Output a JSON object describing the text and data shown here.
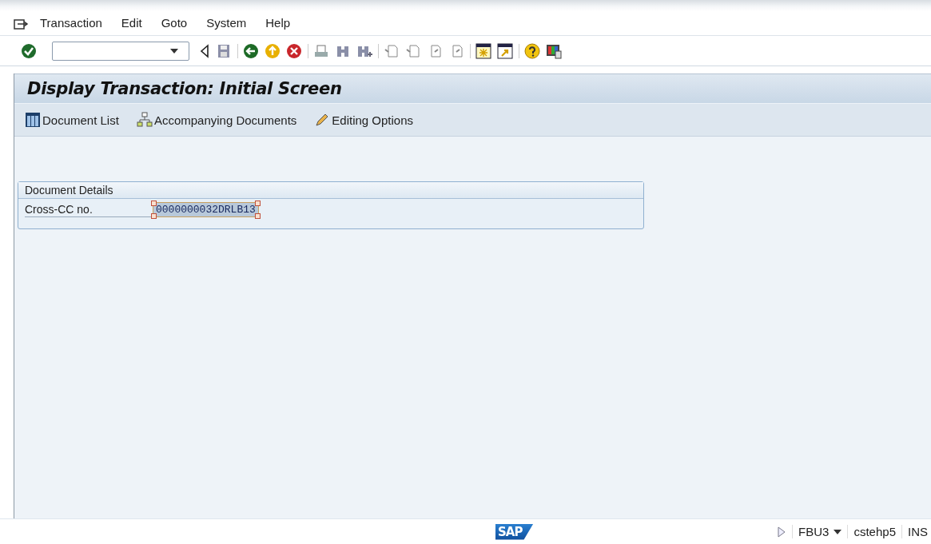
{
  "menu": [
    {
      "label": "Transaction"
    },
    {
      "label": "Edit"
    },
    {
      "label": "Goto"
    },
    {
      "label": "System"
    },
    {
      "label": "Help"
    }
  ],
  "title": "Display Transaction: Initial Screen",
  "app_toolbar": [
    {
      "kind": "list",
      "label": "Document List"
    },
    {
      "kind": "docs",
      "label": "Accompanying Documents"
    },
    {
      "kind": "pencil",
      "label": "Editing Options"
    }
  ],
  "group": {
    "title": "Document Details",
    "fields": [
      {
        "label": "Cross-CC no.",
        "value": "0000000032DRLB13",
        "selected": true
      }
    ]
  },
  "status_bar": {
    "logo": "SAP",
    "transaction": "FBU3",
    "server": "cstehp5",
    "mode": "INS"
  }
}
